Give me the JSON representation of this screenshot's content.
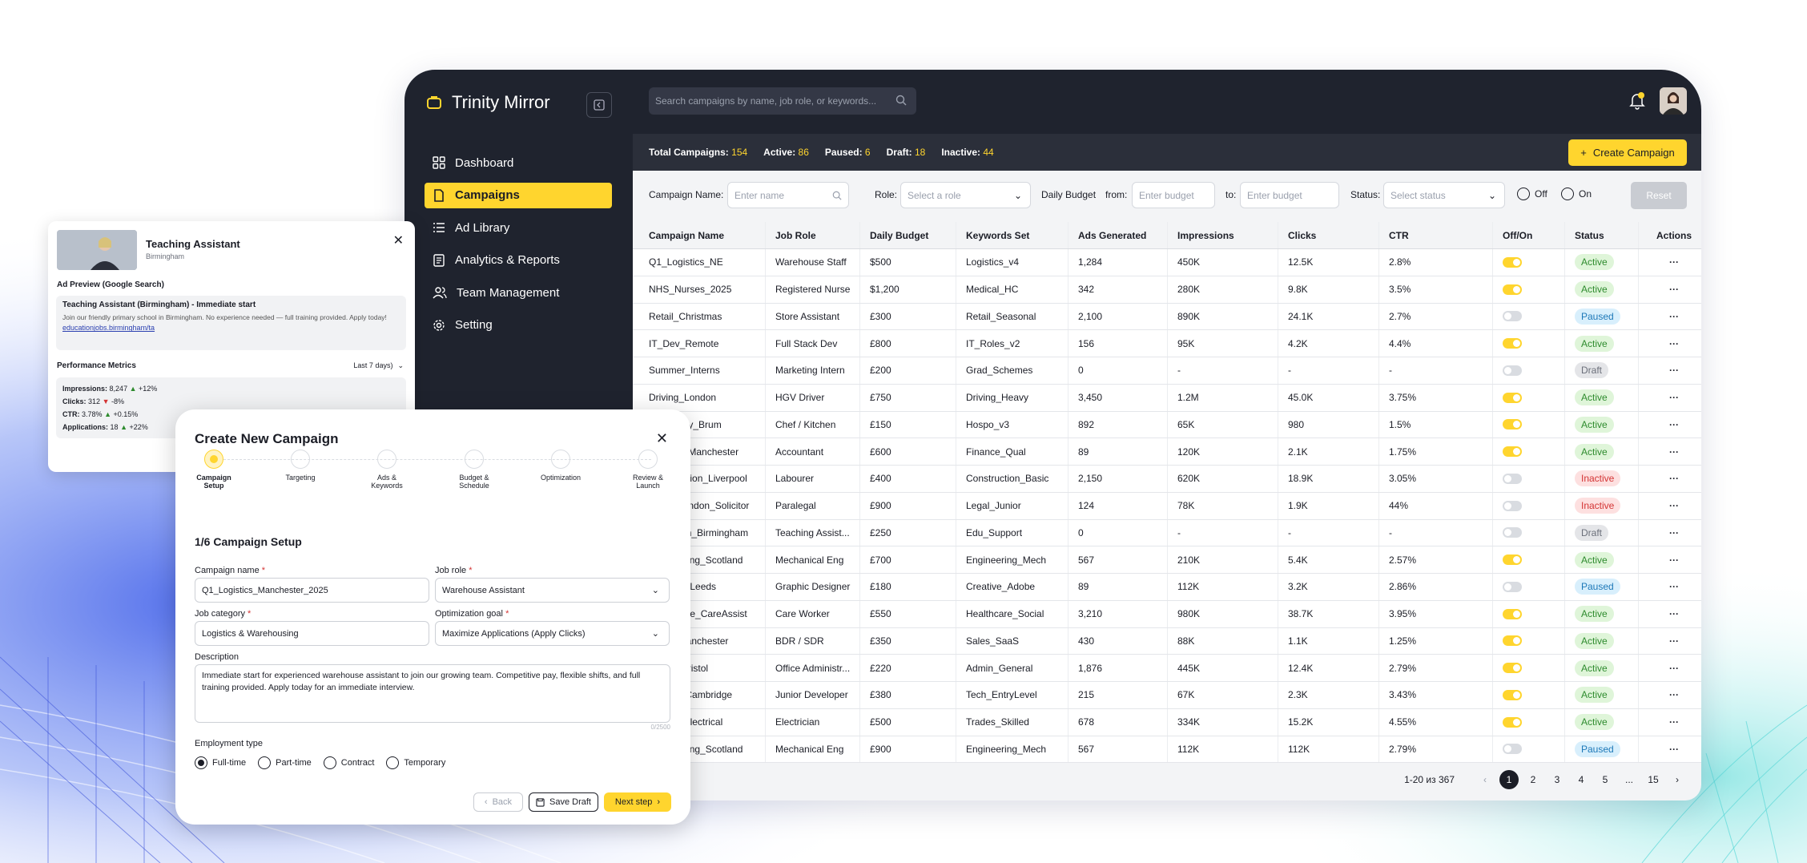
{
  "app": {
    "brand": "Trinity Mirror",
    "nav": [
      {
        "label": "Dashboard",
        "icon": "grid-icon",
        "active": false
      },
      {
        "label": "Campaigns",
        "icon": "file-icon",
        "active": true
      },
      {
        "label": "Ad Library",
        "icon": "list-icon",
        "active": false
      },
      {
        "label": "Analytics & Reports",
        "icon": "report-icon",
        "active": false
      },
      {
        "label": "Team Management",
        "icon": "team-icon",
        "active": false
      },
      {
        "label": "Setting",
        "icon": "gear-icon",
        "active": false
      }
    ],
    "search_placeholder": "Search campaigns by name, job role, or keywords...",
    "stats": {
      "total_label": "Total Campaigns:",
      "total": "154",
      "active_label": "Active:",
      "active": "86",
      "paused_label": "Paused:",
      "paused": "6",
      "draft_label": "Draft:",
      "draft": "18",
      "inactive_label": "Inactive:",
      "inactive": "44"
    },
    "create_label": "Create Campaign",
    "filters": {
      "name_label": "Campaign Name:",
      "name_placeholder": "Enter name",
      "role_label": "Role:",
      "role_placeholder": "Select a role",
      "budget_label": "Daily Budget",
      "from_label": "from:",
      "from_placeholder": "Enter budget",
      "to_label": "to:",
      "to_placeholder": "Enter budget",
      "status_label": "Status:",
      "status_placeholder": "Select status",
      "off_label": "Off",
      "on_label": "On",
      "reset_label": "Reset"
    },
    "table": {
      "headers": [
        "Campaign Name",
        "Job Role",
        "Daily Budget",
        "Keywords Set",
        "Ads Generated",
        "Impressions",
        "Clicks",
        "CTR",
        "Off/On",
        "Status",
        "Actions"
      ],
      "rows": [
        [
          "Q1_Logistics_NE",
          "Warehouse Staff",
          "$500",
          "Logistics_v4",
          "1,284",
          "450K",
          "12.5K",
          "2.8%",
          "on",
          "Active"
        ],
        [
          "NHS_Nurses_2025",
          "Registered Nurse",
          "$1,200",
          "Medical_HC",
          "342",
          "280K",
          "9.8K",
          "3.5%",
          "on",
          "Active"
        ],
        [
          "Retail_Christmas",
          "Store Assistant",
          "£300",
          "Retail_Seasonal",
          "2,100",
          "890K",
          "24.1K",
          "2.7%",
          "off",
          "Paused"
        ],
        [
          "IT_Dev_Remote",
          "Full Stack Dev",
          "£800",
          "IT_Roles_v2",
          "156",
          "95K",
          "4.2K",
          "4.4%",
          "on",
          "Active"
        ],
        [
          "Summer_Interns",
          "Marketing Intern",
          "£200",
          "Grad_Schemes",
          "0",
          "-",
          "-",
          "-",
          "off",
          "Draft"
        ],
        [
          "Driving_London",
          "HGV Driver",
          "£750",
          "Driving_Heavy",
          "3,450",
          "1.2M",
          "45.0K",
          "3.75%",
          "on",
          "Active"
        ],
        [
          "Hospitality_Brum",
          "Chef / Kitchen",
          "£150",
          "Hospo_v3",
          "892",
          "65K",
          "980",
          "1.5%",
          "on",
          "Active"
        ],
        [
          "Finance_Manchester",
          "Accountant",
          "£600",
          "Finance_Qual",
          "89",
          "120K",
          "2.1K",
          "1.75%",
          "on",
          "Active"
        ],
        [
          "Construction_Liverpool",
          "Labourer",
          "£400",
          "Construction_Basic",
          "2,150",
          "620K",
          "18.9K",
          "3.05%",
          "off",
          "Inactive"
        ],
        [
          "Legal_London_Solicitor",
          "Paralegal",
          "£900",
          "Legal_Junior",
          "124",
          "78K",
          "1.9K",
          "44%",
          "off",
          "Inactive"
        ],
        [
          "Education_Birmingham",
          "Teaching Assist...",
          "£250",
          "Edu_Support",
          "0",
          "-",
          "-",
          "-",
          "off",
          "Draft"
        ],
        [
          "Engineering_Scotland",
          "Mechanical Eng",
          "£700",
          "Engineering_Mech",
          "567",
          "210K",
          "5.4K",
          "2.57%",
          "on",
          "Active"
        ],
        [
          "Creative_Leeds",
          "Graphic Designer",
          "£180",
          "Creative_Adobe",
          "89",
          "112K",
          "3.2K",
          "2.86%",
          "off",
          "Paused"
        ],
        [
          "Healthcare_CareAssist",
          "Care Worker",
          "£550",
          "Healthcare_Social",
          "3,210",
          "980K",
          "38.7K",
          "3.95%",
          "on",
          "Active"
        ],
        [
          "Sales_Manchester",
          "BDR / SDR",
          "£350",
          "Sales_SaaS",
          "430",
          "88K",
          "1.1K",
          "1.25%",
          "on",
          "Active"
        ],
        [
          "Admin_Bristol",
          "Office Administr...",
          "£220",
          "Admin_General",
          "1,876",
          "445K",
          "12.4K",
          "2.79%",
          "on",
          "Active"
        ],
        [
          "Startup_Cambridge",
          "Junior Developer",
          "£380",
          "Tech_EntryLevel",
          "215",
          "67K",
          "2.3K",
          "3.43%",
          "on",
          "Active"
        ],
        [
          "Trades_Electrical",
          "Electrician",
          "£500",
          "Trades_Skilled",
          "678",
          "334K",
          "15.2K",
          "4.55%",
          "on",
          "Active"
        ],
        [
          "Engineering_Scotland",
          "Mechanical Eng",
          "£900",
          "Engineering_Mech",
          "567",
          "112K",
          "112K",
          "2.79%",
          "off",
          "Paused"
        ]
      ]
    },
    "pager": {
      "range": "1-20 из 367",
      "pages": [
        "1",
        "2",
        "3",
        "4",
        "5",
        "...",
        "15"
      ],
      "current": "1"
    }
  },
  "preview": {
    "title": "Teaching Assistant",
    "location": "Birmingham",
    "section_title": "Ad Preview (Google Search)",
    "ad_headline": "Teaching Assistant (Birmingham) - Immediate start",
    "ad_body": "Join our friendly primary school in Birmingham. No experience needed — full training provided. Apply today!",
    "ad_link": "educationjobs.birmingham/ta",
    "metrics_title": "Performance Metrics",
    "range": "Last 7 days)",
    "metrics": [
      {
        "label": "Impressions:",
        "value": "8,247",
        "trend": "up",
        "delta": "+12%"
      },
      {
        "label": "Clicks:",
        "value": "312",
        "trend": "down",
        "delta": "-8%"
      },
      {
        "label": "CTR:",
        "value": "3.78%",
        "trend": "up",
        "delta": "+0.15%"
      },
      {
        "label": "Applications:",
        "value": "18",
        "trend": "up",
        "delta": "+22%"
      }
    ]
  },
  "modal": {
    "title": "Create New Campaign",
    "steps": [
      "Campaign Setup",
      "Targeting",
      "Ads & Keywords",
      "Budget & Schedule",
      "Optimization",
      "Review & Launch"
    ],
    "section": "1/6 Campaign Setup",
    "campaign_name_label": "Campaign name",
    "campaign_name": "Q1_Logistics_Manchester_2025",
    "job_role_label": "Job role",
    "job_role": "Warehouse Assistant",
    "job_category_label": "Job category",
    "job_category": "Logistics & Warehousing",
    "goal_label": "Optimization goal",
    "goal": "Maximize Applications (Apply Clicks)",
    "description_label": "Description",
    "description": "Immediate start for experienced warehouse assistant to join our growing team. Competitive pay, flexible shifts, and full training provided. Apply today for an immediate interview.",
    "char_count": "0/2500",
    "employment_label": "Employment type",
    "employment_types": [
      "Full-time",
      "Part-time",
      "Contract",
      "Temporary"
    ],
    "employment_selected": "Full-time",
    "back_label": "Back",
    "save_label": "Save Draft",
    "next_label": "Next step"
  },
  "colors": {
    "accent": "#ffd52e",
    "sidebar": "#1f232e",
    "active_badge": "#dff5d9",
    "paused_badge": "#d8effc",
    "inactive_badge": "#fde0e0"
  }
}
